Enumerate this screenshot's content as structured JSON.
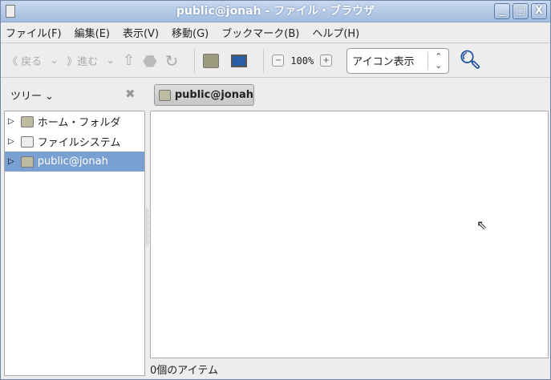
{
  "window": {
    "title": "public@jonah - ファイル・ブラウザ",
    "minimize": "_",
    "maximize": "□",
    "close": "X"
  },
  "menu": [
    "ファイル(F)",
    "編集(E)",
    "表示(V)",
    "移動(G)",
    "ブックマーク(B)",
    "ヘルプ(H)"
  ],
  "toolbar": {
    "back": "戻る",
    "forward": "進む",
    "zoom_level": "100%",
    "view_mode": "アイコン表示"
  },
  "sidebar": {
    "title": "ツリー",
    "items": [
      {
        "label": "ホーム・フォルダ",
        "icon": "home-folder-icon"
      },
      {
        "label": "ファイルシステム",
        "icon": "filesystem-icon"
      },
      {
        "label": "public@jonah",
        "icon": "network-folder-icon",
        "selected": true
      }
    ]
  },
  "location": {
    "path_button": "public@jonah"
  },
  "status": {
    "text": "0個のアイテム"
  }
}
